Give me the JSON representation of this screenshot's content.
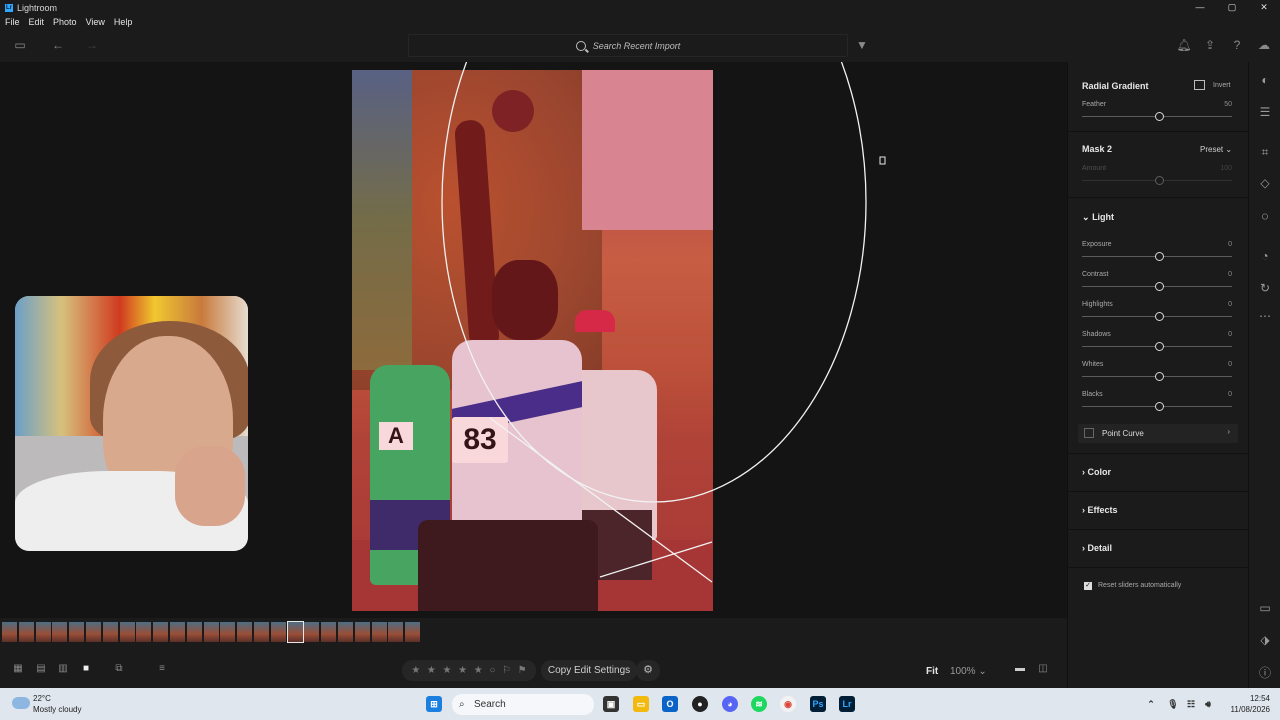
{
  "window": {
    "title": "Lightroom",
    "controls": [
      "—",
      "▢",
      "✕"
    ]
  },
  "menu": [
    "File",
    "Edit",
    "Photo",
    "View",
    "Help"
  ],
  "search": {
    "placeholder": "Search Recent Import"
  },
  "panel": {
    "radial_title": "Radial Gradient",
    "invert_label": "Invert",
    "feather": {
      "label": "Feather",
      "value": "50"
    },
    "mask_title": "Mask 2",
    "preset_label": "Preset",
    "amount": {
      "label": "Amount",
      "value": "100"
    },
    "light_title": "Light",
    "light_sliders": [
      {
        "label": "Exposure",
        "value": "0"
      },
      {
        "label": "Contrast",
        "value": "0"
      },
      {
        "label": "Highlights",
        "value": "0"
      },
      {
        "label": "Shadows",
        "value": "0"
      },
      {
        "label": "Whites",
        "value": "0"
      },
      {
        "label": "Blacks",
        "value": "0"
      }
    ],
    "point_curve": "Point Curve",
    "color_title": "Color",
    "effects_title": "Effects",
    "detail_title": "Detail",
    "reset_label": "Reset sliders automatically"
  },
  "photo": {
    "bib_left": "A",
    "bib_main": "83"
  },
  "bottom": {
    "copy_settings": "Copy Edit Settings",
    "fit": "Fit",
    "zoom": "100%"
  },
  "taskbar": {
    "temp": "22°C",
    "weather": "Mostly cloudy",
    "search": "Search",
    "time": "12:54",
    "date": "11/08/2026"
  },
  "colors": {
    "accent": "#31a8ff",
    "mask": "#dc283c"
  }
}
